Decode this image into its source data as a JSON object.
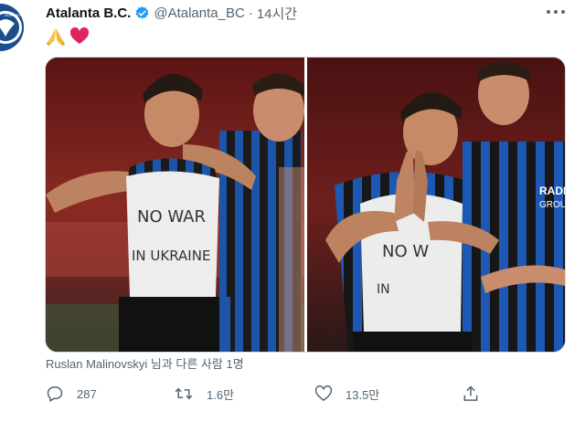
{
  "tweet": {
    "author_name": "Atalanta B.C.",
    "handle": "@Atalanta_BC",
    "separator": "·",
    "time": "14시간",
    "emojis": [
      "praying-hands",
      "red-heart"
    ],
    "media": {
      "photo_left": {
        "shirt_text": [
          "NO WAR",
          "IN UKRAINE"
        ]
      },
      "photo_right": {
        "shirt_text": [
          "NO W",
          "IN"
        ],
        "sleeve_text": [
          "RADICI",
          "GROUP"
        ]
      }
    },
    "tagged_text": "Ruslan Malinovskyi 님과 다른 사람 1명"
  },
  "actions": {
    "reply_count": "287",
    "retweet_count": "1.6만",
    "like_count": "13.5만"
  },
  "colors": {
    "secondary_text": "#536471",
    "verified_blue": "#1d9bf0",
    "heart_red": "#e0245e",
    "atalanta_blue": "#1c4e8c"
  }
}
